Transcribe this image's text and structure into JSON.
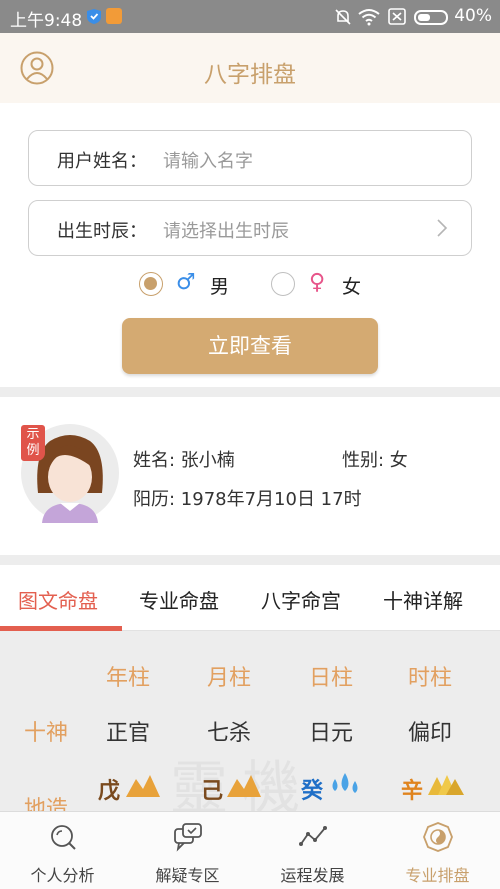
{
  "status_bar": {
    "time": "上午9:48",
    "battery": "40%"
  },
  "header": {
    "title": "八字排盘"
  },
  "form": {
    "name_label": "用户姓名：",
    "name_placeholder": "请输入名字",
    "birth_label": "出生时辰：",
    "birth_placeholder": "请选择出生时辰",
    "gender_male": "男",
    "gender_female": "女",
    "gender_selected": "男",
    "submit_label": "立即查看"
  },
  "example": {
    "tag": "示例",
    "name": "姓名: 张小楠",
    "gender": "性别: 女",
    "birth": "阳历: 1978年7月10日 17时"
  },
  "tabs": [
    "图文命盘",
    "专业命盘",
    "八字命宫",
    "十神详解"
  ],
  "active_tab": "图文命盘",
  "chart": {
    "columns": [
      "年柱",
      "月柱",
      "日柱",
      "时柱"
    ],
    "row_labels": [
      "十神",
      "地造"
    ],
    "shishen": [
      "正官",
      "七杀",
      "日元",
      "偏印"
    ],
    "stems": [
      {
        "char": "戊",
        "color": "#7a4a1e",
        "element": "earth"
      },
      {
        "char": "己",
        "color": "#7a4a1e",
        "element": "earth"
      },
      {
        "char": "癸",
        "color": "#1f6fc7",
        "element": "water"
      },
      {
        "char": "辛",
        "color": "#e0841e",
        "element": "metal"
      }
    ]
  },
  "bottom_nav": [
    {
      "label": "个人分析",
      "icon": "search-icon"
    },
    {
      "label": "解疑专区",
      "icon": "chat-icon"
    },
    {
      "label": "运程发展",
      "icon": "trend-icon"
    },
    {
      "label": "专业排盘",
      "icon": "bagua-icon"
    }
  ],
  "active_nav": "专业排盘",
  "colors": {
    "accent": "#c8a06c",
    "tab_active": "#e35f4f",
    "column_header": "#e2a060"
  }
}
